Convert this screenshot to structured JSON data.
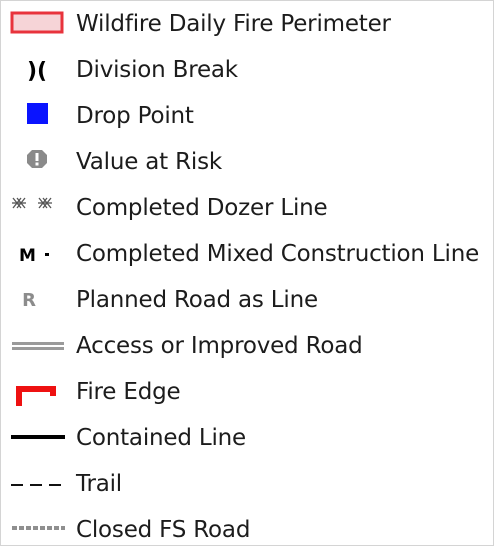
{
  "legend": {
    "items": [
      {
        "label": "Wildfire Daily Fire Perimeter",
        "icon": "fire-perimeter-swatch-icon",
        "color": "#e8333c",
        "fill": "#f6d4d7"
      },
      {
        "label": "Division Break",
        "icon": "division-break-icon",
        "glyph": ")("
      },
      {
        "label": "Drop Point",
        "icon": "drop-point-square-icon",
        "color": "#0a14ff"
      },
      {
        "label": "Value at Risk",
        "icon": "value-at-risk-icon",
        "color": "#8a8a8a"
      },
      {
        "label": "Completed Dozer Line",
        "icon": "completed-dozer-line-icon",
        "color": "#555555"
      },
      {
        "label": "Completed Mixed Construction Line",
        "icon": "mixed-construction-line-icon",
        "glyph": "M"
      },
      {
        "label": "Planned Road as Line",
        "icon": "planned-road-icon",
        "glyph": "R",
        "color": "#8c8c8c"
      },
      {
        "label": "Access or Improved Road",
        "icon": "access-road-icon",
        "color": "#9a9a9a"
      },
      {
        "label": "Fire Edge",
        "icon": "fire-edge-icon",
        "color": "#ee1111"
      },
      {
        "label": "Contained Line",
        "icon": "contained-line-icon",
        "color": "#000000"
      },
      {
        "label": "Trail",
        "icon": "trail-dashed-icon",
        "color": "#111111"
      },
      {
        "label": "Closed FS Road",
        "icon": "closed-fs-road-icon",
        "color": "#8f8f8f"
      }
    ]
  }
}
